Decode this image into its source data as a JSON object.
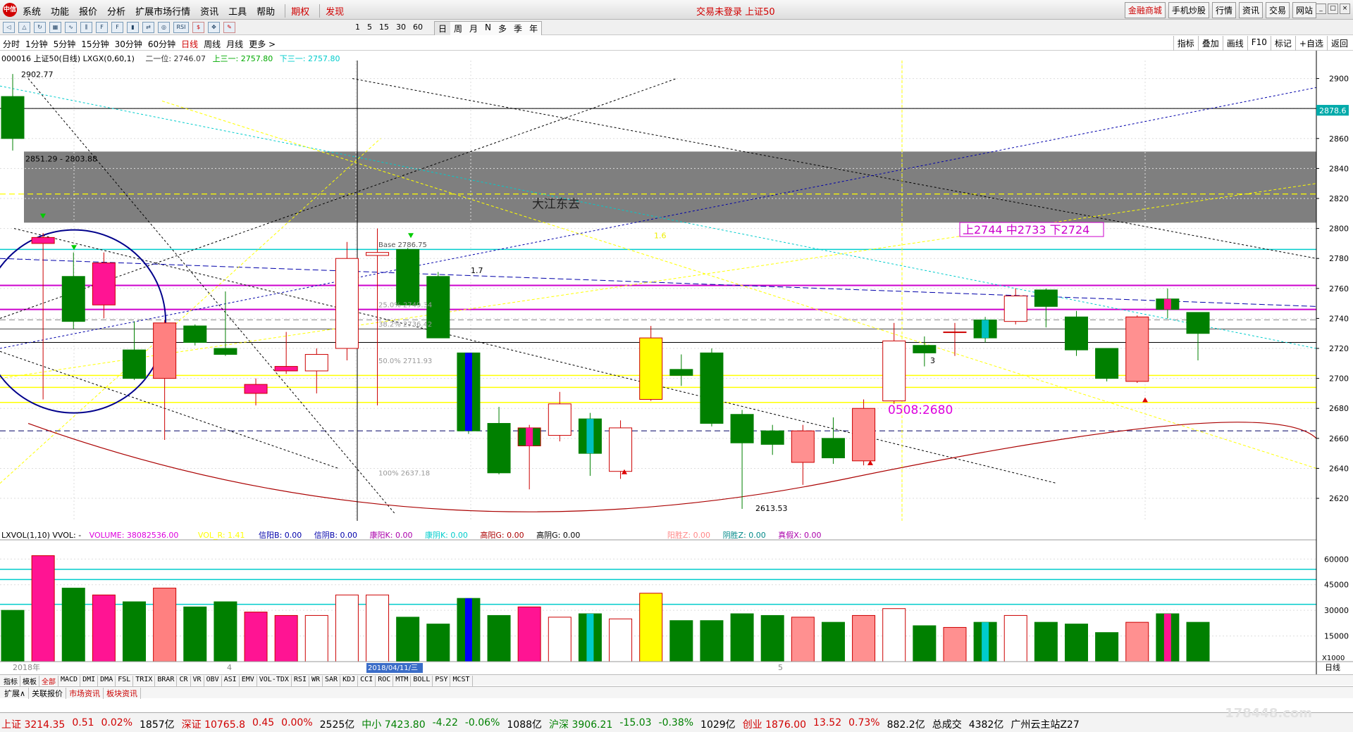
{
  "menubar": {
    "logo": "中信",
    "menus": [
      "系统",
      "功能",
      "报价",
      "分析",
      "扩展市场行情",
      "资讯",
      "工具",
      "帮助"
    ],
    "menus_hl": [
      "期权",
      "发现"
    ],
    "status": "交易未登录   上证50",
    "right_buttons": [
      "金融商城",
      "手机炒股",
      "行情",
      "资讯",
      "交易",
      "网站"
    ]
  },
  "toolbar": {
    "icons": [
      "back-icon",
      "up-icon",
      "refresh-icon",
      "grid-icon",
      "line-icon",
      "kline-icon",
      "f10-icon",
      "fund-icon",
      "bar-icon",
      "cmp-icon",
      "svc-icon",
      "rsi-icon",
      "money-icon",
      "move-icon",
      "pen-icon"
    ],
    "icon_labels": [
      "◁",
      "△",
      "↻",
      "▦",
      "∿",
      "⫼",
      "F",
      "F",
      "▮",
      "⇄",
      "◎",
      "RSI",
      "$",
      "✥",
      "✎"
    ],
    "periods": [
      "1",
      "5",
      "15",
      "30",
      "60"
    ],
    "periods2": [
      "日",
      "周",
      "月",
      "N",
      "多",
      "季",
      "年"
    ],
    "period_selected": "日"
  },
  "tabbar": {
    "tabs": [
      "分时",
      "1分钟",
      "5分钟",
      "15分钟",
      "30分钟",
      "60分钟",
      "日线",
      "周线",
      "月线",
      "更多 >"
    ],
    "selected": "日线",
    "right_tabs": [
      "指标",
      "叠加",
      "画线",
      "F10",
      "标记",
      "+自选",
      "返回"
    ]
  },
  "indicator_line": {
    "title": "000016 上证50(日线) LXGX(0,60,1)",
    "l1": "二一位: 2746.07",
    "l2": "上三一: 2757.80",
    "l3": "下三一: 2757.80"
  },
  "annotations": {
    "high": "2902.77",
    "range": "2851.29 - 2803.88",
    "label_da": "大江东去",
    "ranges_box": "上2744 中2733 下2724",
    "base": "Base 2786.75",
    "p17": "1.7",
    "p16": "1.6",
    "fib25": "25.0% 2749.34",
    "fib382": "38.2% 2736.42",
    "fib50": "50.0% 2711.93",
    "fib100": "100% 2637.18",
    "low": "2613.53",
    "date_note": "0508:2680",
    "num3a": "3",
    "price_tag": "2878.6"
  },
  "price_axis": {
    "ticks": [
      2900,
      2880,
      2860,
      2840,
      2820,
      2800,
      2780,
      2760,
      2740,
      2720,
      2700,
      2680,
      2660,
      2640,
      2620
    ],
    "min": 2605,
    "max": 2912
  },
  "vol_axis": {
    "ticks": [
      "60000",
      "45000",
      "30000",
      "15000"
    ],
    "unit": "X1000"
  },
  "date_axis": {
    "labels": [
      "2018年",
      "4",
      "2018/04/11/三",
      "5"
    ],
    "right": "日线"
  },
  "volume_header": {
    "name": "LXVOL(1,10) VVOL: -",
    "volume": "VOLUME: 38082536.00",
    "vol_r": "VOL_R: 1.41",
    "items": [
      "信阳B: 0.00",
      "信阴B: 0.00",
      "康阳K: 0.00",
      "康阴K: 0.00",
      "高阳G: 0.00",
      "高阴G: 0.00",
      "阳胜Z: 0.00",
      "阴胜Z: 0.00",
      "真假X: 0.00"
    ]
  },
  "chart_data": {
    "type": "candlestick",
    "candles": [
      {
        "o": 2860,
        "h": 2903,
        "l": 2852,
        "c": 2888,
        "col": "g"
      },
      {
        "o": 2790,
        "h": 2797,
        "l": 2686,
        "c": 2794,
        "col": "p"
      },
      {
        "o": 2768,
        "h": 2784,
        "l": 2733,
        "c": 2738,
        "col": "g"
      },
      {
        "o": 2777,
        "h": 2784,
        "l": 2740,
        "c": 2749,
        "col": "m"
      },
      {
        "o": 2719,
        "h": 2738,
        "l": 2699,
        "c": 2700,
        "col": "g"
      },
      {
        "o": 2700,
        "h": 2739,
        "l": 2659,
        "c": 2737,
        "col": "ph"
      },
      {
        "o": 2735,
        "h": 2736,
        "l": 2722,
        "c": 2724,
        "col": "g"
      },
      {
        "o": 2720,
        "h": 2758,
        "l": 2715,
        "c": 2716,
        "col": "g"
      },
      {
        "o": 2690,
        "h": 2700,
        "l": 2682,
        "c": 2696,
        "col": "p"
      },
      {
        "o": 2705,
        "h": 2731,
        "l": 2703,
        "c": 2708,
        "col": "m"
      },
      {
        "o": 2705,
        "h": 2720,
        "l": 2690,
        "c": 2716,
        "col": "h"
      },
      {
        "o": 2720,
        "h": 2791,
        "l": 2712,
        "c": 2780,
        "col": "h"
      },
      {
        "o": 2782,
        "h": 2800,
        "l": 2682,
        "c": 2784,
        "col": "h"
      },
      {
        "o": 2786,
        "h": 2787,
        "l": 2750,
        "c": 2749,
        "col": "g"
      },
      {
        "o": 2768,
        "h": 2771,
        "l": 2727,
        "c": 2727,
        "col": "g"
      },
      {
        "o": 2717,
        "h": 2717,
        "l": 2663,
        "c": 2665,
        "col": "gb"
      },
      {
        "o": 2670,
        "h": 2681,
        "l": 2636,
        "c": 2637,
        "col": "g"
      },
      {
        "o": 2667,
        "h": 2669,
        "l": 2626,
        "c": 2655,
        "col": "pg"
      },
      {
        "o": 2662,
        "h": 2691,
        "l": 2658,
        "c": 2683,
        "col": "h"
      },
      {
        "o": 2673,
        "h": 2677,
        "l": 2635,
        "c": 2650,
        "col": "gc"
      },
      {
        "o": 2638,
        "h": 2672,
        "l": 2633,
        "c": 2667,
        "col": "h"
      },
      {
        "o": 2686,
        "h": 2735,
        "l": 2685,
        "c": 2727,
        "col": "y"
      },
      {
        "o": 2706,
        "h": 2716,
        "l": 2695,
        "c": 2702,
        "col": "g"
      },
      {
        "o": 2717,
        "h": 2720,
        "l": 2668,
        "c": 2670,
        "col": "g"
      },
      {
        "o": 2676,
        "h": 2679,
        "l": 2613,
        "c": 2657,
        "col": "g"
      },
      {
        "o": 2665,
        "h": 2669,
        "l": 2649,
        "c": 2656,
        "col": "g"
      },
      {
        "o": 2644,
        "h": 2669,
        "l": 2629,
        "c": 2665,
        "col": "pk"
      },
      {
        "o": 2660,
        "h": 2674,
        "l": 2643,
        "c": 2647,
        "col": "g"
      },
      {
        "o": 2645,
        "h": 2686,
        "l": 2642,
        "c": 2680,
        "col": "pk"
      },
      {
        "o": 2685,
        "h": 2737,
        "l": 2683,
        "c": 2725,
        "col": "h"
      },
      {
        "o": 2722,
        "h": 2728,
        "l": 2708,
        "c": 2717,
        "col": "g"
      },
      {
        "o": 2731,
        "h": 2737,
        "l": 2715,
        "c": 2731,
        "col": "pk"
      },
      {
        "o": 2727,
        "h": 2741,
        "l": 2724,
        "c": 2739,
        "col": "gc"
      },
      {
        "o": 2738,
        "h": 2760,
        "l": 2736,
        "c": 2755,
        "col": "h"
      },
      {
        "o": 2759,
        "h": 2760,
        "l": 2734,
        "c": 2748,
        "col": "g"
      },
      {
        "o": 2741,
        "h": 2745,
        "l": 2715,
        "c": 2719,
        "col": "g"
      },
      {
        "o": 2720,
        "h": 2720,
        "l": 2698,
        "c": 2700,
        "col": "g"
      },
      {
        "o": 2698,
        "h": 2742,
        "l": 2697,
        "c": 2741,
        "col": "pk"
      },
      {
        "o": 2746,
        "h": 2760,
        "l": 2740,
        "c": 2753,
        "col": "gm"
      },
      {
        "o": 2744,
        "h": 2744,
        "l": 2712,
        "c": 2730,
        "col": "g"
      }
    ],
    "volumes": [
      30,
      62,
      43,
      39,
      35,
      43,
      32,
      35,
      29,
      27,
      27,
      39,
      39,
      26,
      22,
      37,
      27,
      32,
      26,
      28,
      25,
      40,
      24,
      24,
      28,
      27,
      26,
      23,
      27,
      31,
      21,
      20,
      23,
      27,
      23,
      22,
      17,
      23,
      28,
      23
    ],
    "volume_colors": [
      "g",
      "p",
      "g",
      "m",
      "g",
      "ph",
      "g",
      "g",
      "m",
      "m",
      "h",
      "h",
      "h",
      "g",
      "g",
      "gb",
      "g",
      "m",
      "h",
      "gc",
      "h",
      "y",
      "g",
      "g",
      "g",
      "g",
      "pk",
      "g",
      "pk",
      "h",
      "g",
      "pk",
      "gc",
      "h",
      "g",
      "g",
      "g",
      "pk",
      "gm",
      "g"
    ]
  },
  "bottombar1": {
    "items": [
      "指标",
      "模板",
      "全部",
      "MACD",
      "DMI",
      "DMA",
      "FSL",
      "TRIX",
      "BRAR",
      "CR",
      "VR",
      "OBV",
      "ASI",
      "EMV",
      "VOL-TDX",
      "RSI",
      "WR",
      "SAR",
      "KDJ",
      "CCI",
      "ROC",
      "MTM",
      "BOLL",
      "PSY",
      "MCST"
    ],
    "selected": "全部"
  },
  "bottombar2": {
    "items": [
      "扩展∧",
      "关联报价",
      "市场资讯",
      "板块资讯"
    ]
  },
  "ticker": {
    "items": [
      {
        "name": "上证",
        "val": "3214.35",
        "chg": "0.51",
        "pct": "0.02%",
        "amt": "1857亿",
        "dir": "up"
      },
      {
        "name": "深证",
        "val": "10765.8",
        "chg": "0.45",
        "pct": "0.00%",
        "amt": "2525亿",
        "dir": "up"
      },
      {
        "name": "中小",
        "val": "7423.80",
        "chg": "-4.22",
        "pct": "-0.06%",
        "amt": "1088亿",
        "dir": "dn"
      },
      {
        "name": "沪深",
        "val": "3906.21",
        "chg": "-15.03",
        "pct": "-0.38%",
        "amt": "1029亿",
        "dir": "dn"
      },
      {
        "name": "创业",
        "val": "1876.00",
        "chg": "13.52",
        "pct": "0.73%",
        "amt": "882.2亿",
        "dir": "up"
      }
    ],
    "total_label": "总成交",
    "total": "4382亿",
    "station": "广州云主站Z27"
  },
  "watermark": "178448.com"
}
